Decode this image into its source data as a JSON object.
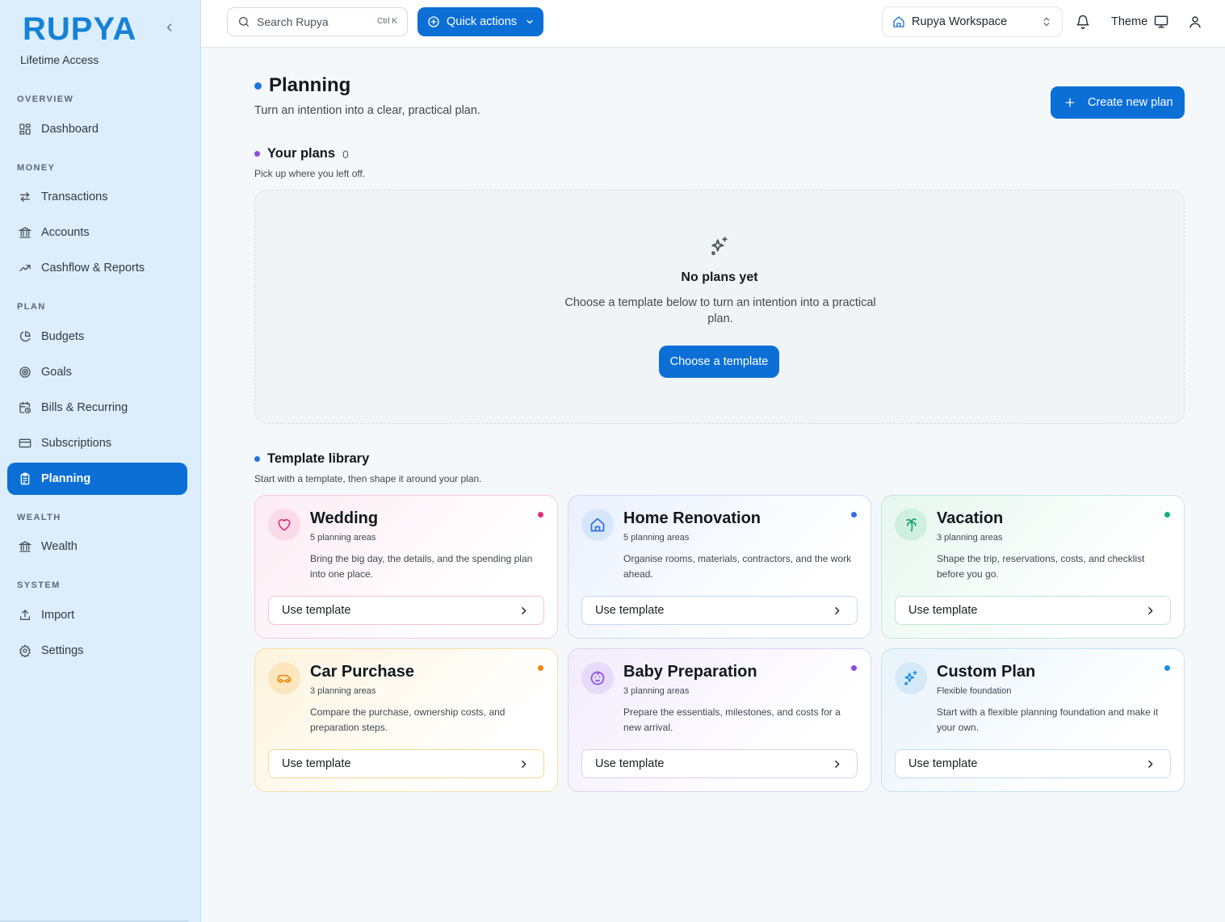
{
  "brand": {
    "logo_text": "RUPYA",
    "plan_label": "Lifetime Access"
  },
  "sidebar": {
    "sections": [
      {
        "label": "OVERVIEW",
        "items": [
          {
            "label": "Dashboard",
            "icon": "dashboard-icon"
          }
        ]
      },
      {
        "label": "MONEY",
        "items": [
          {
            "label": "Transactions",
            "icon": "arrows-icon"
          },
          {
            "label": "Accounts",
            "icon": "bank-icon"
          },
          {
            "label": "Cashflow & Reports",
            "icon": "trend-icon"
          }
        ]
      },
      {
        "label": "PLAN",
        "items": [
          {
            "label": "Budgets",
            "icon": "pie-icon"
          },
          {
            "label": "Goals",
            "icon": "target-icon"
          },
          {
            "label": "Bills & Recurring",
            "icon": "calendar-clock-icon"
          },
          {
            "label": "Subscriptions",
            "icon": "card-icon"
          },
          {
            "label": "Planning",
            "icon": "clipboard-icon",
            "active": true
          }
        ]
      },
      {
        "label": "WEALTH",
        "items": [
          {
            "label": "Wealth",
            "icon": "bank-icon"
          }
        ]
      },
      {
        "label": "SYSTEM",
        "items": [
          {
            "label": "Import",
            "icon": "upload-icon"
          },
          {
            "label": "Settings",
            "icon": "gear-icon"
          }
        ]
      }
    ]
  },
  "topbar": {
    "search_placeholder": "Search Rupya",
    "search_shortcut": "Ctrl K",
    "quick_actions_label": "Quick actions",
    "workspace_label": "Rupya Workspace",
    "theme_label": "Theme"
  },
  "page": {
    "title": "Planning",
    "subtitle": "Turn an intention into a clear, practical plan.",
    "create_button": "Create new plan"
  },
  "your_plans": {
    "title": "Your plans",
    "count": "0",
    "subtitle": "Pick up where you left off.",
    "empty_title": "No plans yet",
    "empty_text": "Choose a template below to turn an intention into a practical plan.",
    "empty_button": "Choose a template"
  },
  "library": {
    "title": "Template library",
    "subtitle": "Start with a template, then shape it around your plan.",
    "button_label": "Use template",
    "templates": [
      {
        "title": "Wedding",
        "meta": "5 planning areas",
        "description": "Bring the big day, the details, and the spending plan into one place.",
        "icon": "heart-icon",
        "accent": "#e0307a"
      },
      {
        "title": "Home Renovation",
        "meta": "5 planning areas",
        "description": "Organise rooms, materials, contractors, and the work ahead.",
        "icon": "home-icon",
        "accent": "#2f6fe0"
      },
      {
        "title": "Vacation",
        "meta": "3 planning areas",
        "description": "Shape the trip, reservations, costs, and checklist before you go.",
        "icon": "palm-tree-icon",
        "accent": "#12b07a"
      },
      {
        "title": "Car Purchase",
        "meta": "3 planning areas",
        "description": "Compare the purchase, ownership costs, and preparation steps.",
        "icon": "car-icon",
        "accent": "#ef8a10"
      },
      {
        "title": "Baby Preparation",
        "meta": "3 planning areas",
        "description": "Prepare the essentials, milestones, and costs for a new arrival.",
        "icon": "baby-icon",
        "accent": "#8a4ce0"
      },
      {
        "title": "Custom Plan",
        "meta": "Flexible foundation",
        "description": "Start with a flexible planning foundation and make it your own.",
        "icon": "sparkles-icon",
        "accent": "#1b8fe0"
      }
    ]
  }
}
